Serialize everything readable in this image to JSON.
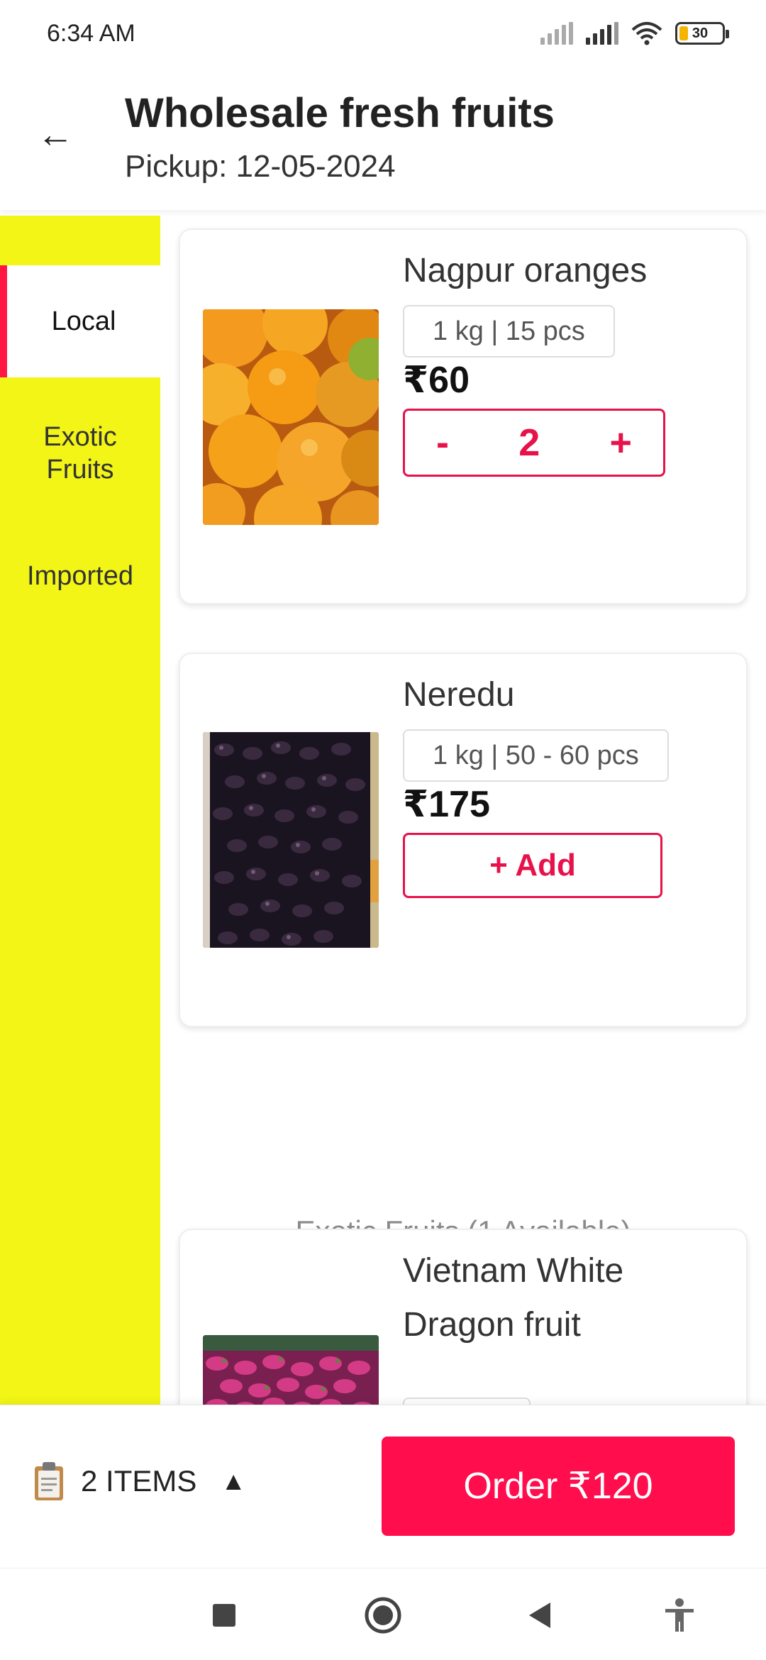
{
  "status_bar": {
    "time": "6:34 AM",
    "battery": "30"
  },
  "header": {
    "title": "Wholesale fresh fruits",
    "subtitle": "Pickup: 12-05-2024"
  },
  "sidebar": {
    "items": [
      {
        "label": "Local",
        "active": true
      },
      {
        "label": "Exotic\nFruits",
        "active": false
      },
      {
        "label": "Imported",
        "active": false
      }
    ]
  },
  "products": [
    {
      "name": "Nagpur oranges",
      "unit": "1 kg | 15 pcs",
      "price": "₹60",
      "quantity": "2",
      "minus": "-",
      "plus": "+",
      "image_icon": "oranges-image"
    },
    {
      "name": "Neredu",
      "unit": "1 kg | 50 - 60 pcs",
      "price": "₹175",
      "add_label": "+ Add",
      "image_icon": "jamun-image"
    },
    {
      "name": "Vietnam White Dragon fruit",
      "image_icon": "dragon-fruit-image"
    }
  ],
  "section_heading": "-- Exotic Fruits (1 Available) --",
  "order_bar": {
    "items_label": "2 ITEMS",
    "caret": "▲",
    "order_label": "Order ₹120"
  },
  "colors": {
    "accent": "#ff0d4d",
    "sidebar_bg": "#f2f516",
    "active_marker": "#ff1744"
  }
}
